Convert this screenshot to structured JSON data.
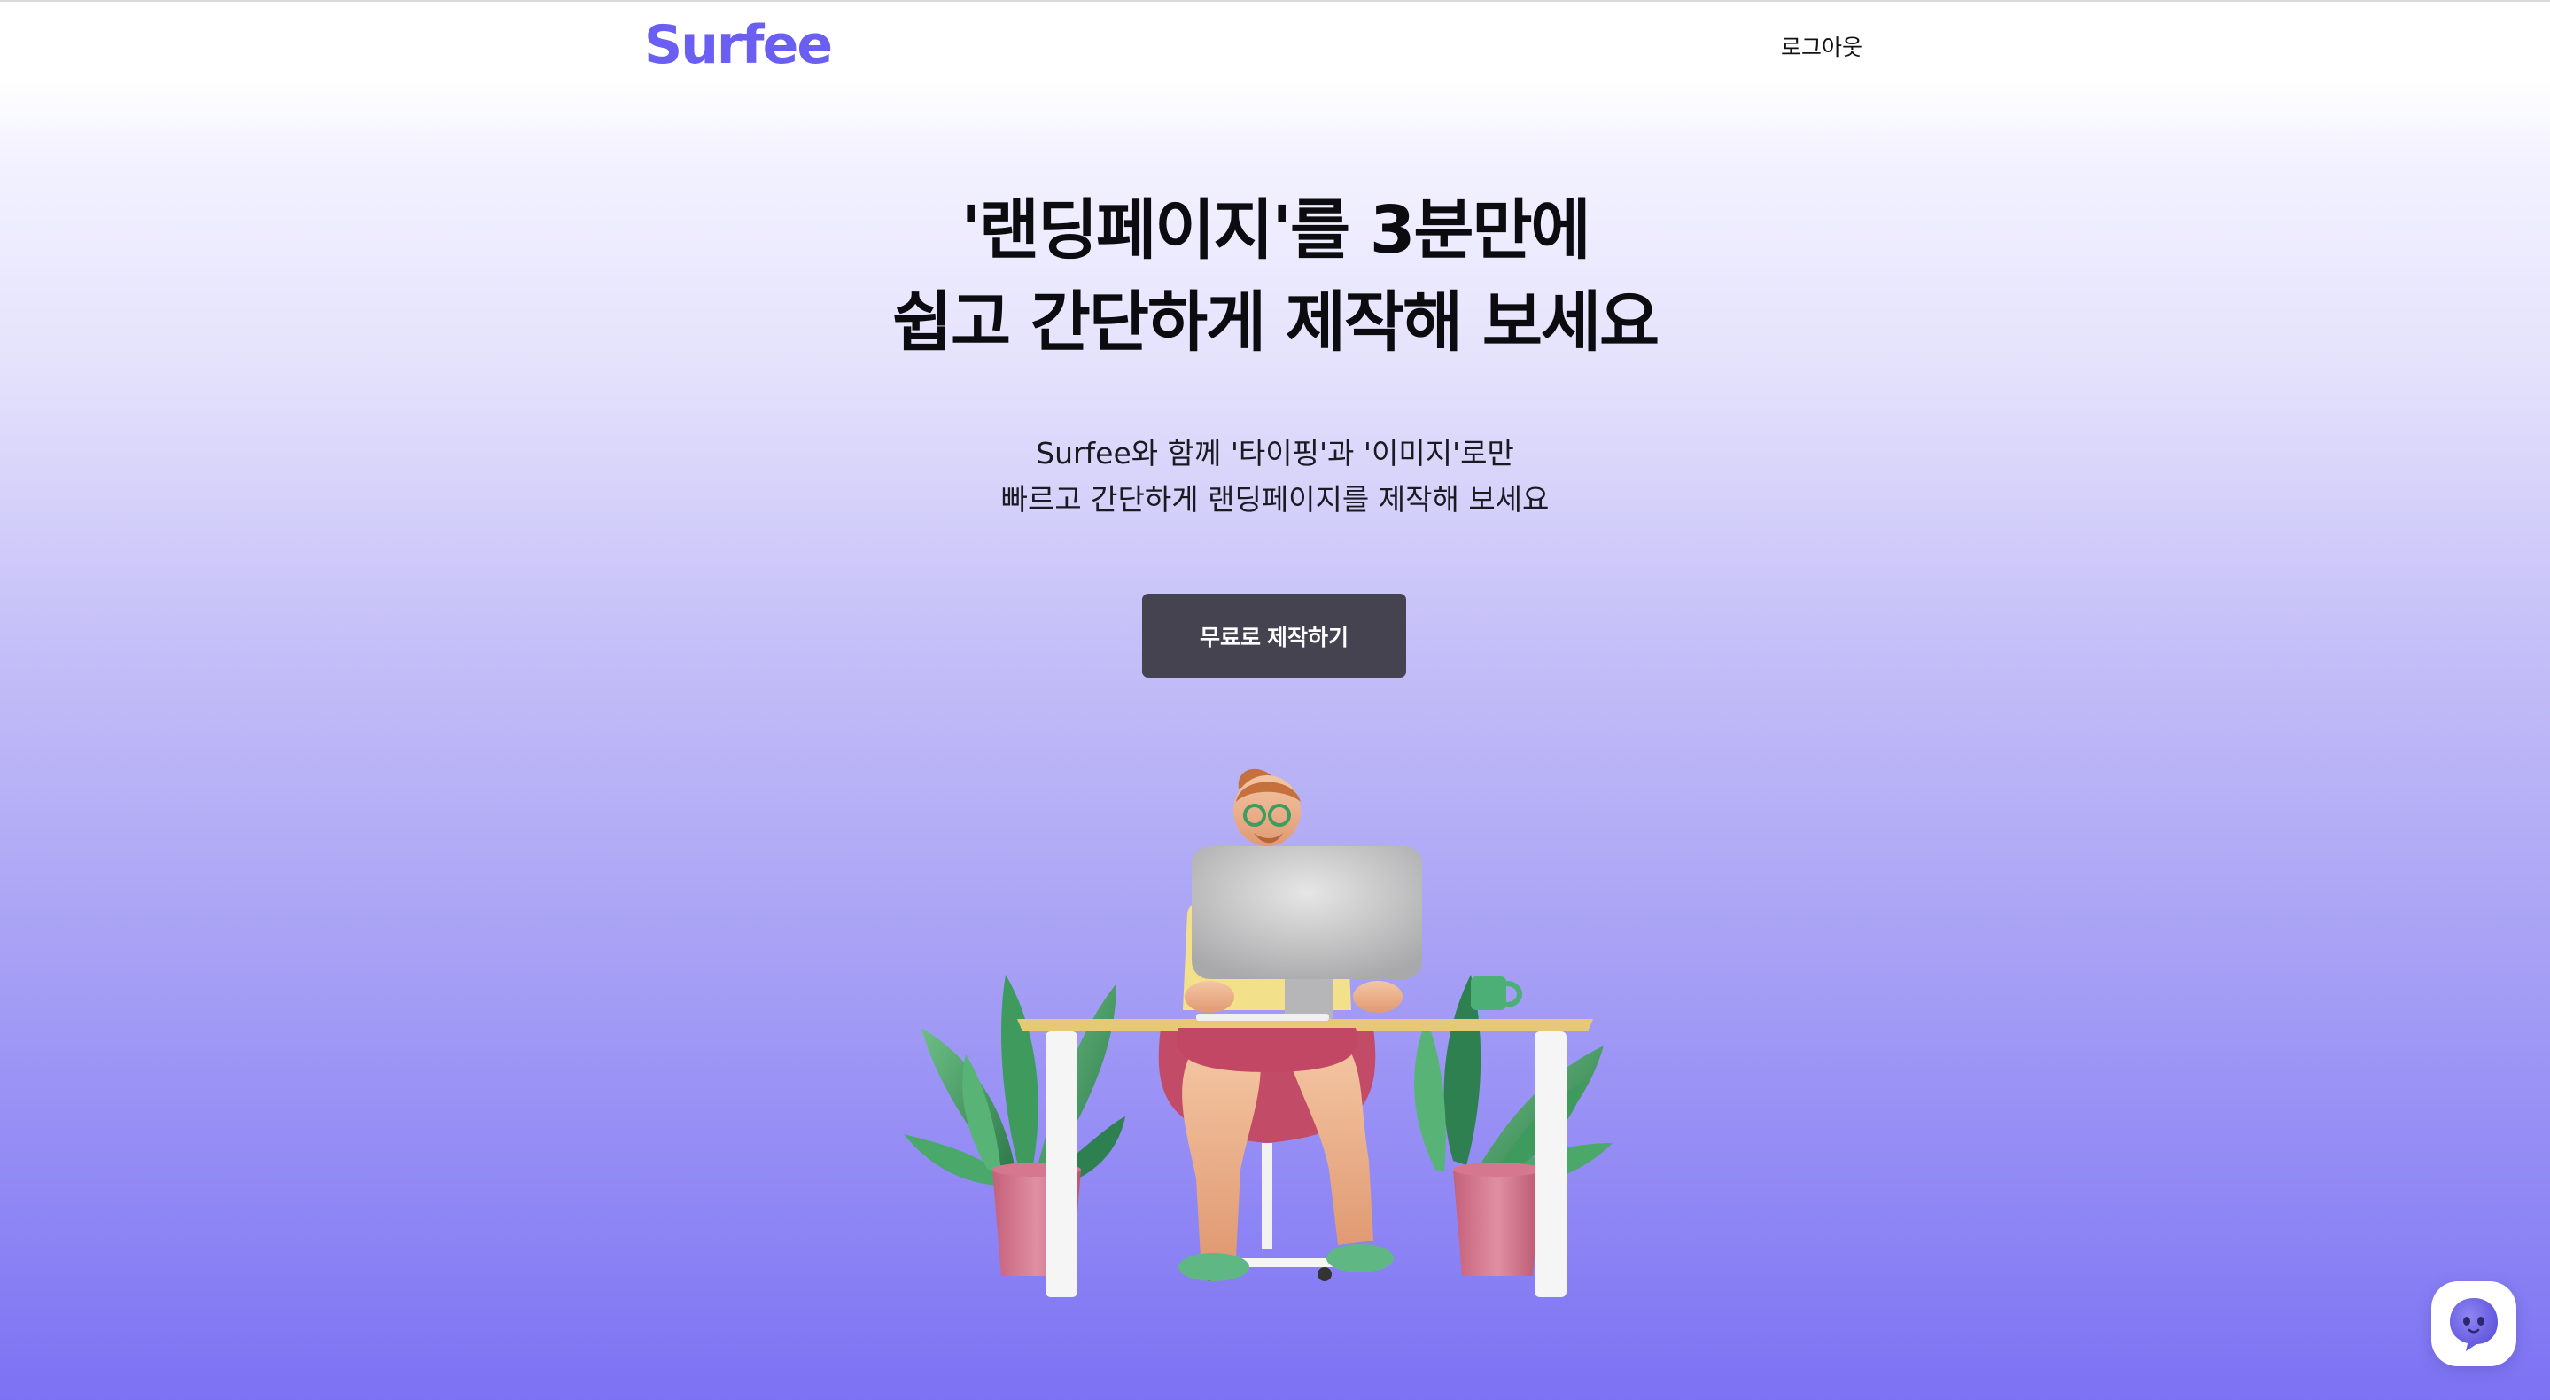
{
  "header": {
    "logo_text": "Surfee",
    "logout_label": "로그아웃"
  },
  "hero": {
    "title_line1": "'랜딩페이지'를 3분만에",
    "title_line2": "쉽고 간단하게 제작해 보세요",
    "subtitle_line1": "Surfee와 함께 '타이핑'과 '이미지'로만",
    "subtitle_line2": "빠르고 간단하게 랜딩페이지를 제작해 보세요",
    "cta_label": "무료로 제작하기"
  },
  "illustration": {
    "icon": "person-at-desk-illustration"
  },
  "chat": {
    "icon": "chat-bot-icon"
  },
  "colors": {
    "brand": "#6a5ff2",
    "cta_bg": "#44434f",
    "gradient_bottom": "#7c72f3"
  }
}
